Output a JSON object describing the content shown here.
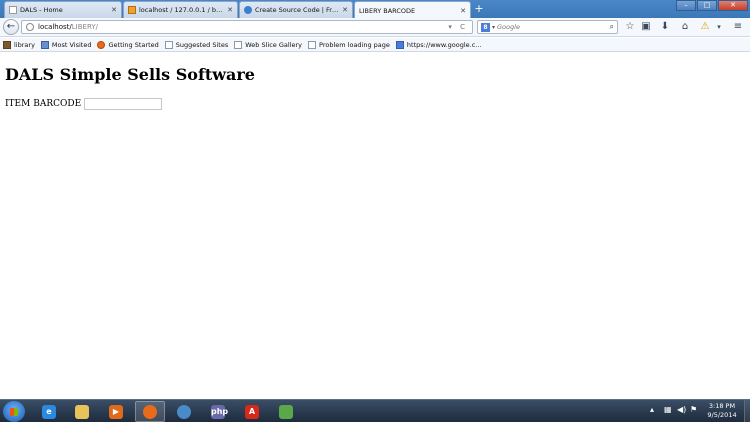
{
  "browser": {
    "tabs": [
      {
        "label": "DALS - Home",
        "icon": "blank-page-icon",
        "active": false
      },
      {
        "label": "localhost / 127.0.0.1 / barc...",
        "icon": "phpmyadmin-icon",
        "active": false
      },
      {
        "label": "Create Source Code | Free s...",
        "icon": "page-icon",
        "active": false
      },
      {
        "label": "LIBERY BARCODE",
        "icon": "blank-page-icon",
        "active": true
      }
    ],
    "new_tab_label": "+",
    "address": {
      "host": "localhost/",
      "path": "LIBERY/"
    },
    "search_placeholder": "Google",
    "bookmarks": [
      {
        "label": "library",
        "icon": "folder-icon"
      },
      {
        "label": "Most Visited",
        "icon": "star-icon"
      },
      {
        "label": "Getting Started",
        "icon": "firefox-icon"
      },
      {
        "label": "Suggested Sites",
        "icon": "page-icon"
      },
      {
        "label": "Web Slice Gallery",
        "icon": "page-icon"
      },
      {
        "label": "Problem loading page",
        "icon": "page-icon"
      },
      {
        "label": "https://www.google.c...",
        "icon": "google-icon"
      }
    ]
  },
  "page": {
    "title": "DALS Simple Sells Software",
    "barcode_label": "ITEM BARCODE",
    "barcode_value": ""
  },
  "taskbar": {
    "time": "3:18 PM",
    "date": "9/5/2014"
  },
  "colors": {
    "titlebar": "#3c78b8",
    "taskbar": "#1d2b3c"
  }
}
